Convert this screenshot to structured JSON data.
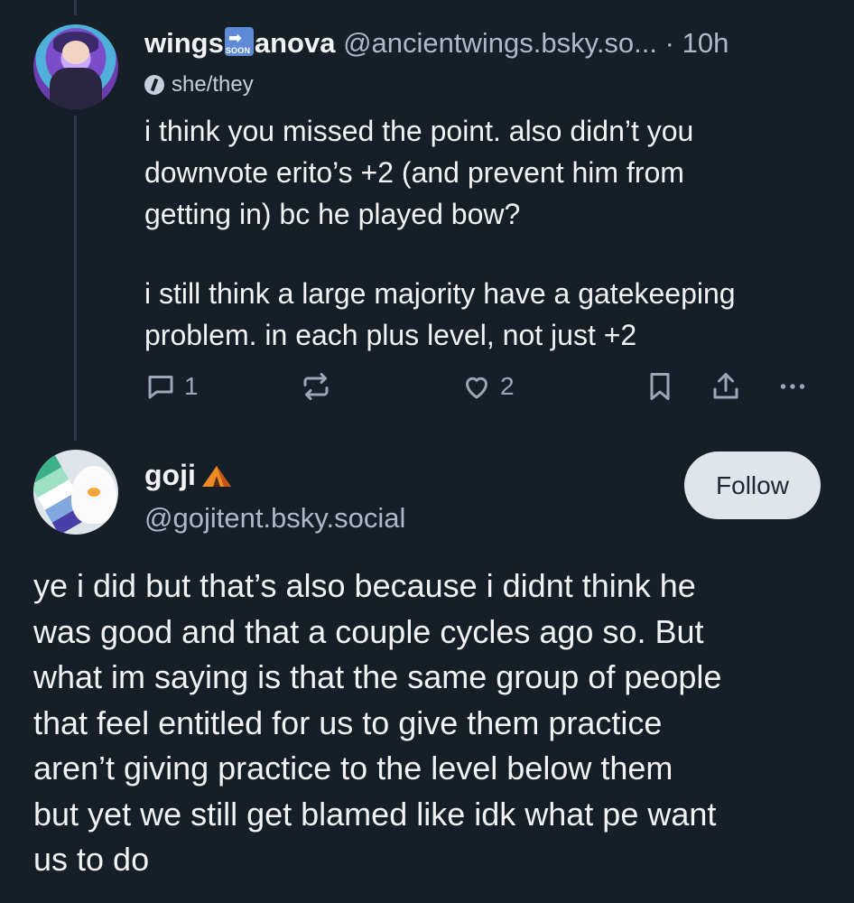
{
  "post1": {
    "name_part1": "wings",
    "name_emoji": "➡️ SOON",
    "name_part2": "anova",
    "handle": "@ancientwings.bsky.so...",
    "separator": "·",
    "time": "10h",
    "pronouns": "she/they",
    "text_lines_a": [
      "i think you missed the point. also didn’t you",
      "downvote erito’s +2 (and prevent him from",
      "getting in) bc he played bow?"
    ],
    "text_lines_b": [
      "i still think a large majority have a gatekeeping",
      "problem. in each plus level, not just +2"
    ],
    "reply_count": "1",
    "repost_count": "",
    "like_count": "2"
  },
  "post2": {
    "name": "goji",
    "name_emoji": "tent",
    "handle": "@gojitent.bsky.social",
    "follow_label": "Follow",
    "text_lines": [
      "ye i did but that’s also because i didnt think he",
      "was good and that a couple cycles ago so. But",
      "what im saying is that the same group of people",
      "that feel entitled for us to give them practice",
      "aren’t giving practice to the level below them",
      "but yet we still get blamed like idk what pe want",
      "us to do"
    ]
  },
  "colors": {
    "background": "#161e27",
    "text": "#f1f3f5",
    "muted": "#9aa7b6",
    "follow_bg": "#dfe5eb"
  },
  "icons": [
    "reply-icon",
    "repost-icon",
    "like-icon",
    "bookmark-icon",
    "share-icon",
    "more-icon",
    "pronoun-icon",
    "soon-emoji",
    "tent-emoji"
  ]
}
